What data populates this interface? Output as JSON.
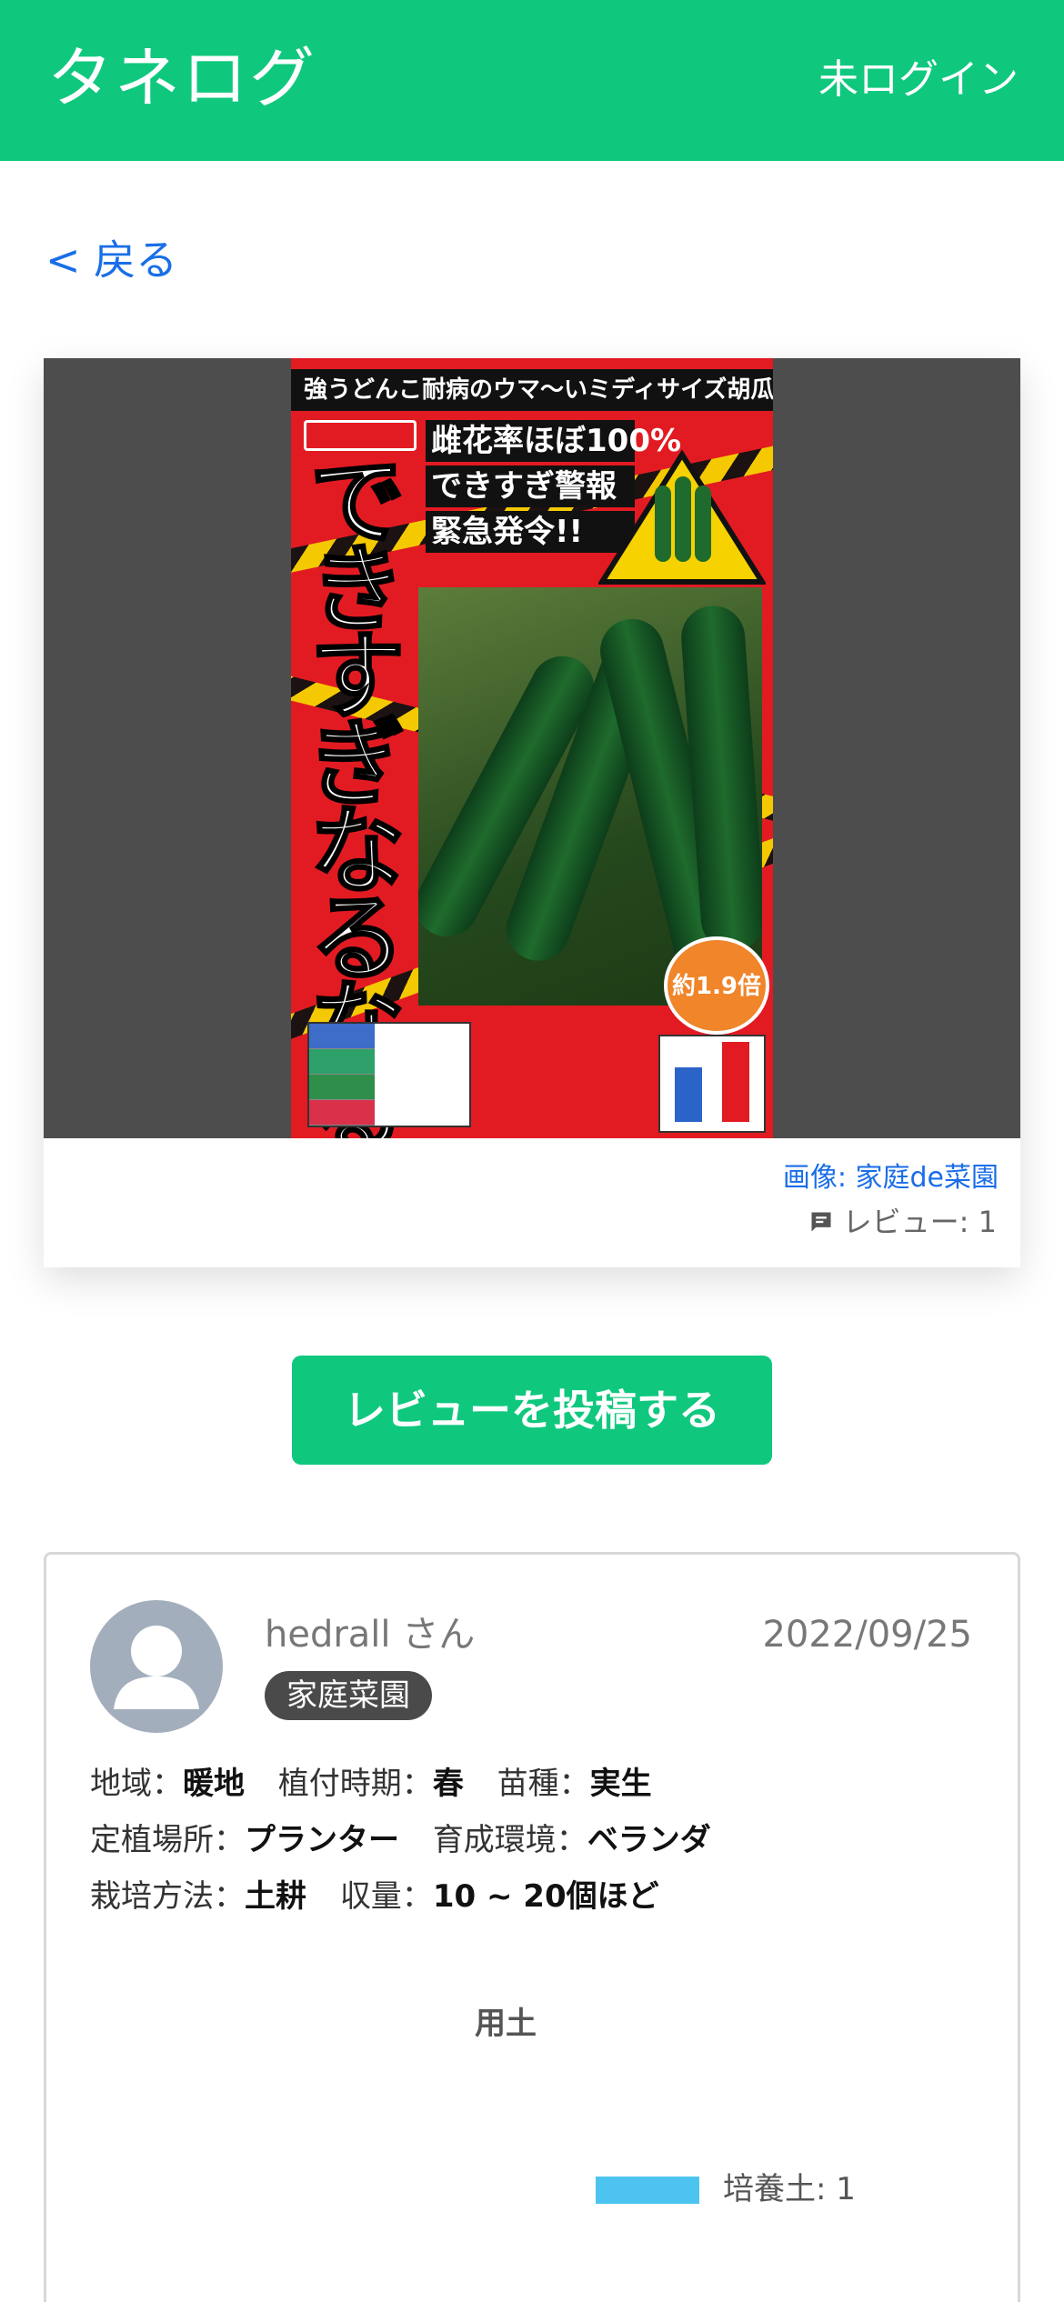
{
  "header": {
    "title": "タネログ",
    "login_label": "未ログイン"
  },
  "nav": {
    "back_label": "< 戻る"
  },
  "product": {
    "pack_caption": "強うどんこ耐病のウマ～いミディサイズ胡瓜",
    "pack_title": "できすぎなるなる",
    "pack_headline": [
      "雌花率ほぼ100%",
      "できすぎ警報",
      "緊急発令!!"
    ],
    "pack_bubble": "約1.9倍",
    "image_credit": "画像: 家庭de菜園",
    "review_count": "レビュー: 1"
  },
  "actions": {
    "post_review_label": "レビューを投稿する"
  },
  "review": {
    "username": "hedrall さん",
    "date": "2022/09/25",
    "badge": "家庭菜園",
    "attrs": {
      "region_label": "地域：",
      "region": "暖地",
      "planting_label": "植付時期：",
      "planting": "春",
      "seedling_label": "苗種：",
      "seedling": "実生",
      "place_label": "定植場所：",
      "place": "プランター",
      "env_label": "育成環境：",
      "env": "ベランダ",
      "method_label": "栽培方法：",
      "method": "土耕",
      "yield_label": "収量：",
      "yield": "10 ~ 20個ほど"
    },
    "soil_chart_title": "用土",
    "legend": [
      {
        "label": "培養土: 1",
        "color": "#4cc4ef"
      }
    ]
  },
  "colors": {
    "brand": "#0fc87e",
    "link": "#1a6ee8"
  },
  "icons": {
    "review": "comment-icon"
  }
}
